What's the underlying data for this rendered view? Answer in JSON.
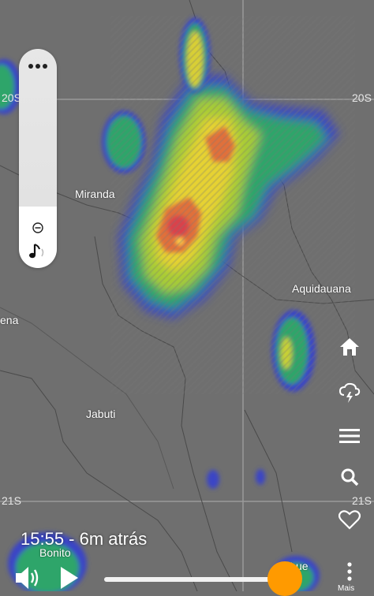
{
  "map": {
    "places": {
      "miranda": "Miranda",
      "aquidauana": "Aquidauana",
      "jabuti": "Jabuti",
      "bonito": "Bonito",
      "left_partial": "ena",
      "bottom_right_partial": "N     ue"
    },
    "latitudes": {
      "top_left": "20S",
      "top_right": "20S",
      "bottom_left": "21S",
      "bottom_right": "21S"
    }
  },
  "left_panel": {
    "menu_icon": "ellipsis-icon",
    "zoom_out_icon": "zoom-out-icon",
    "sound_icon": "music-note-icon"
  },
  "right_toolbar": {
    "home_icon": "home-icon",
    "storm_icon": "thunderstorm-icon",
    "menu_icon": "hamburger-menu-icon",
    "search_icon": "search-icon",
    "favorite_icon": "heart-icon"
  },
  "playback": {
    "time_label": "15:55 - 6m atrás",
    "progress": 0.93,
    "more_label": "Mais"
  },
  "colors": {
    "accent": "#ff9a00",
    "map_background": "#6f6f6f"
  }
}
